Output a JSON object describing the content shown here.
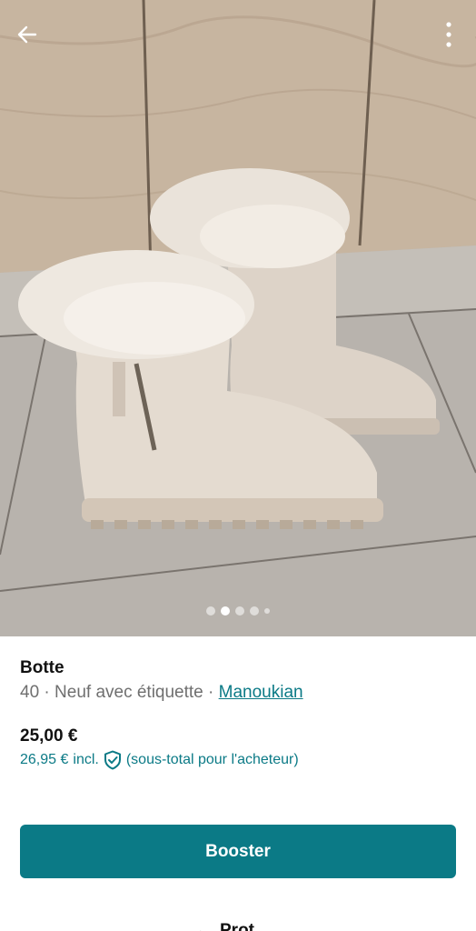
{
  "header": {
    "back_icon": "arrow-left-icon",
    "more_icon": "more-vertical-icon"
  },
  "gallery": {
    "photo_count": 5,
    "active_index": 1
  },
  "item": {
    "title": "Botte",
    "size": "40",
    "condition": "Neuf avec étiquette",
    "separator": "·",
    "brand": "Manoukian"
  },
  "pricing": {
    "price": "25,00 €",
    "total_price": "26,95 €",
    "incl_label": "incl.",
    "note": "(sous-total pour l'acheteur)",
    "protection_icon": "shield-check-icon"
  },
  "actions": {
    "booster_label": "Booster",
    "partial_label": "Prot"
  },
  "colors": {
    "accent": "#0b7a86",
    "muted_text": "#6f6f6f"
  }
}
